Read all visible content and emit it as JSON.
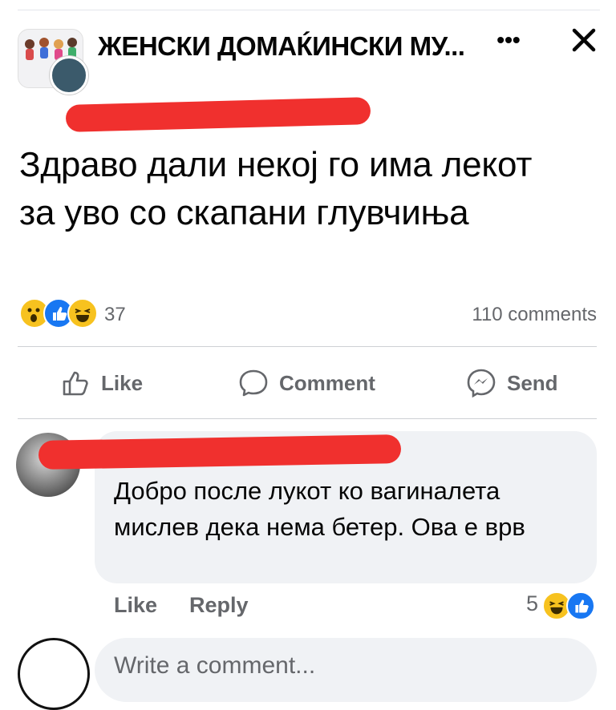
{
  "post": {
    "group_name": "ЖЕНСКИ ДОМАЌИНСКИ МУ...",
    "text": "Здраво дали некој го има лекот за уво со скапани глувчиња",
    "reaction_count": "37",
    "comments_count": "110 comments",
    "reactions": [
      "wow",
      "like",
      "haha"
    ]
  },
  "actions": {
    "like": "Like",
    "comment": "Comment",
    "send": "Send"
  },
  "comment": {
    "text": "Добро после лукот ко вагиналета мислев дека нема бетер. Ова е врв",
    "like": "Like",
    "reply": "Reply",
    "reaction_count": "5",
    "reactions": [
      "haha",
      "like"
    ]
  },
  "composer": {
    "placeholder": "Write a comment..."
  },
  "colors": {
    "accent": "#1877f2",
    "redaction": "#f0302e",
    "bubble": "#f0f2f5",
    "secondary_text": "#65676b"
  }
}
